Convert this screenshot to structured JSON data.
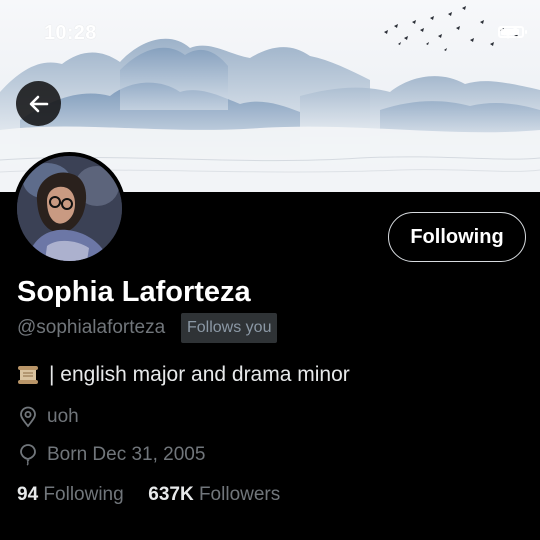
{
  "status_bar": {
    "time": "10:28",
    "wifi_icon": "wifi-icon",
    "battery_icon": "battery-icon"
  },
  "header": {
    "back_icon": "arrow-left-icon"
  },
  "profile": {
    "name": "Sophia Laforteza",
    "handle": "@sophialaforteza",
    "follows_you": "Follows you",
    "follow_button": "Following",
    "bio_emoji": "scroll-emoji",
    "bio_text": "| english major and drama minor",
    "location": "uoh",
    "location_icon": "location-pin-icon",
    "birthday": "Born Dec 31, 2005",
    "birthday_icon": "balloon-icon",
    "following_count": "94",
    "following_label": "Following",
    "followers_count": "637K",
    "followers_label": "Followers"
  },
  "colors": {
    "background": "#000000",
    "text": "#e7e9ea",
    "secondary": "#71767b",
    "badge": "#2f3336"
  }
}
